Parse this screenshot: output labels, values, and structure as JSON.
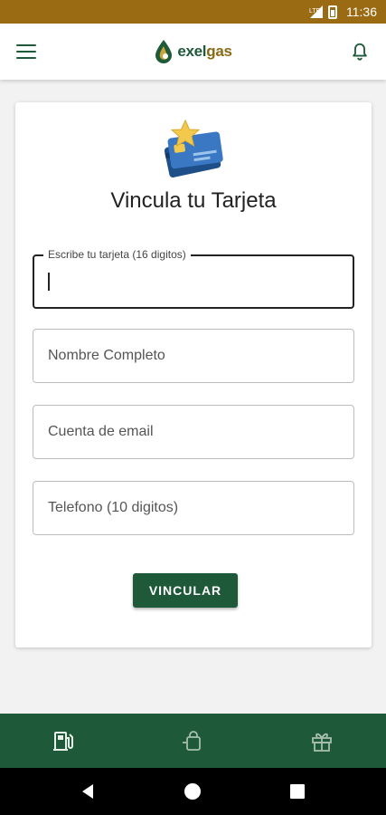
{
  "status_bar": {
    "time": "11:36"
  },
  "app_bar": {
    "logo_prefix": "exel",
    "logo_suffix": "gas"
  },
  "form": {
    "title": "Vincula tu Tarjeta",
    "card_number_label": "Escribe tu tarjeta (16 digitos)",
    "name_placeholder": "Nombre Completo",
    "email_placeholder": "Cuenta de email",
    "phone_placeholder": "Telefono (10 digitos)",
    "submit_label": "VINCULAR"
  },
  "bottom_nav": {
    "items": [
      {
        "icon": "gas-pump-icon"
      },
      {
        "icon": "shopping-bag-icon"
      },
      {
        "icon": "gift-icon"
      }
    ]
  },
  "colors": {
    "status_bar": "#9b6b14",
    "brand_green": "#1e5a3a",
    "brand_gold": "#8a6a14"
  }
}
